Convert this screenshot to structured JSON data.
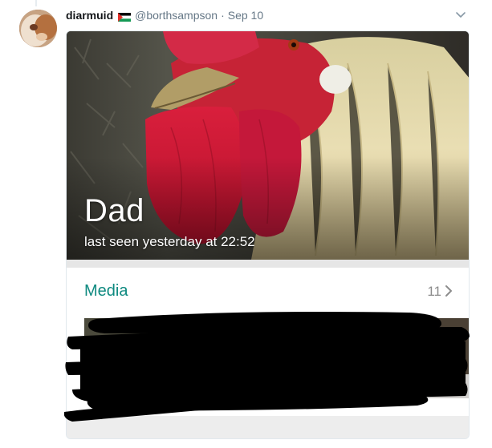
{
  "tweet": {
    "display_name": "diarmuid",
    "handle": "@borthsampson",
    "separator": "·",
    "date": "Sep 10",
    "flag_icon": "palestine-flag-icon",
    "menu_icon": "chevron-down-icon"
  },
  "card": {
    "contact_name": "Dad",
    "last_seen": "last seen yesterday at 22:52",
    "media": {
      "label": "Media",
      "count": "11",
      "chevron_icon": "chevron-right-icon"
    },
    "accent_color": "#0f8a80"
  }
}
